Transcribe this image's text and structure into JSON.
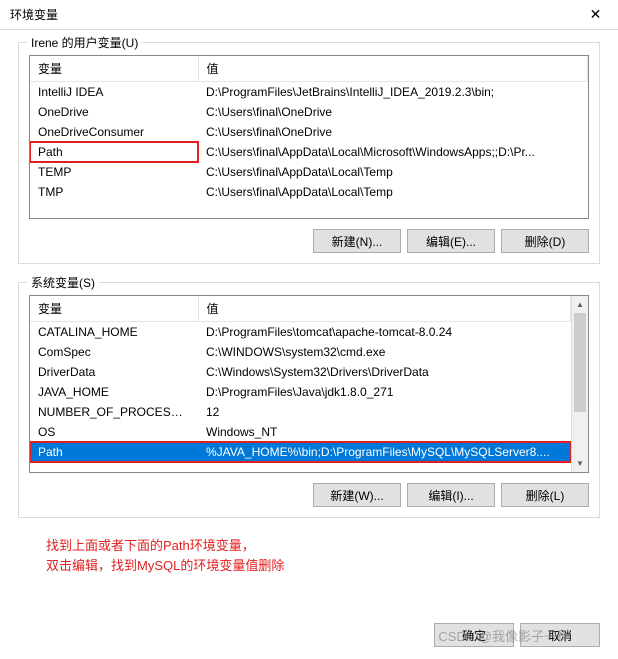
{
  "window": {
    "title": "环境变量",
    "close": "✕"
  },
  "user_vars": {
    "legend": "Irene 的用户变量(U)",
    "col_var": "变量",
    "col_val": "值",
    "rows": [
      {
        "name": "IntelliJ IDEA",
        "value": "D:\\ProgramFiles\\JetBrains\\IntelliJ_IDEA_2019.2.3\\bin;"
      },
      {
        "name": "OneDrive",
        "value": "C:\\Users\\final\\OneDrive"
      },
      {
        "name": "OneDriveConsumer",
        "value": "C:\\Users\\final\\OneDrive"
      },
      {
        "name": "Path",
        "value": "C:\\Users\\final\\AppData\\Local\\Microsoft\\WindowsApps;;D:\\Pr..."
      },
      {
        "name": "TEMP",
        "value": "C:\\Users\\final\\AppData\\Local\\Temp"
      },
      {
        "name": "TMP",
        "value": "C:\\Users\\final\\AppData\\Local\\Temp"
      }
    ],
    "btn_new": "新建(N)...",
    "btn_edit": "编辑(E)...",
    "btn_del": "删除(D)"
  },
  "sys_vars": {
    "legend": "系统变量(S)",
    "col_var": "变量",
    "col_val": "值",
    "rows": [
      {
        "name": "CATALINA_HOME",
        "value": "D:\\ProgramFiles\\tomcat\\apache-tomcat-8.0.24"
      },
      {
        "name": "ComSpec",
        "value": "C:\\WINDOWS\\system32\\cmd.exe"
      },
      {
        "name": "DriverData",
        "value": "C:\\Windows\\System32\\Drivers\\DriverData"
      },
      {
        "name": "JAVA_HOME",
        "value": "D:\\ProgramFiles\\Java\\jdk1.8.0_271"
      },
      {
        "name": "NUMBER_OF_PROCESSORS",
        "value": "12"
      },
      {
        "name": "OS",
        "value": "Windows_NT"
      },
      {
        "name": "Path",
        "value": "%JAVA_HOME%\\bin;D:\\ProgramFiles\\MySQL\\MySQLServer8...."
      }
    ],
    "btn_new": "新建(W)...",
    "btn_edit": "编辑(I)...",
    "btn_del": "删除(L)"
  },
  "annotation": {
    "line1": "找到上面或者下面的Path环境变量，",
    "line2": "双击编辑，找到MySQL的环境变量值删除"
  },
  "footer": {
    "ok": "确定",
    "cancel": "取消",
    "watermark": "CSDN @我像影子一样"
  }
}
